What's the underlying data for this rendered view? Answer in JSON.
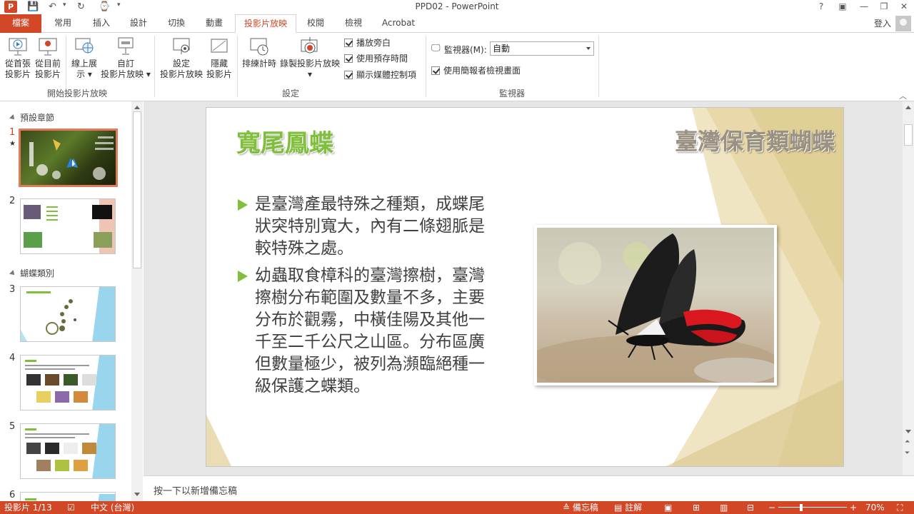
{
  "titlebar": {
    "logo": "P",
    "window_title": "PPD02 - PowerPoint",
    "help": "?",
    "ribbon_display": "▣",
    "minimize": "—",
    "restore": "❐",
    "close": "✕",
    "sign_in": "登入"
  },
  "tabs": [
    "檔案",
    "常用",
    "插入",
    "設計",
    "切換",
    "動畫",
    "投影片放映",
    "校閱",
    "檢視",
    "Acrobat"
  ],
  "ribbon": {
    "start_group": {
      "label": "開始投影片放映",
      "from_beginning": [
        "從首張",
        "投影片"
      ],
      "from_current": [
        "從目前",
        "投影片"
      ],
      "online": [
        "線上展",
        "示 ▾"
      ],
      "custom": [
        "自訂",
        "投影片放映 ▾"
      ]
    },
    "setup_group": {
      "label": "設定",
      "setup": [
        "設定",
        "投影片放映"
      ],
      "hide": [
        "隱藏",
        "投影片"
      ],
      "rehearse": [
        "排練計時"
      ],
      "record": [
        "錄製投影片放映",
        "▾"
      ],
      "check_narration": "播放旁白",
      "check_timings": "使用預存時間",
      "check_media": "顯示媒體控制項"
    },
    "monitor_group": {
      "label": "監視器",
      "monitor_label": "監視器(M):",
      "monitor_value": "自動",
      "presenter_view": "使用簡報者檢視畫面"
    }
  },
  "thumbs": {
    "section1": "預設章節",
    "section2": "蝴蝶類別",
    "slides": [
      {
        "num": "1",
        "star": "★"
      },
      {
        "num": "2"
      },
      {
        "num": "3"
      },
      {
        "num": "4"
      },
      {
        "num": "5"
      },
      {
        "num": "6"
      }
    ]
  },
  "slide": {
    "title": "寬尾鳳蝶",
    "banner": "臺灣保育類蝴蝶",
    "bullets": [
      "是臺灣產最特殊之種類，成蝶尾狀突特別寬大，內有二條翅脈是較特殊之處。",
      "幼蟲取食樟科的臺灣擦樹，臺灣擦樹分布範圍及數量不多，主要分布於觀霧，中橫佳陽及其他一千至二千公尺之山區。分布區廣但數量極少，被列為瀕臨絕種一級保護之蝶類。"
    ]
  },
  "notes": {
    "placeholder": "按一下以新增備忘稿"
  },
  "status": {
    "slide_count": "投影片 1/13",
    "language": "中文 (台灣)",
    "notes": "備忘稿",
    "comments": "註解",
    "zoom": "70%"
  },
  "colors": {
    "accent": "#d24726",
    "title_green": "#7fbf3a"
  }
}
